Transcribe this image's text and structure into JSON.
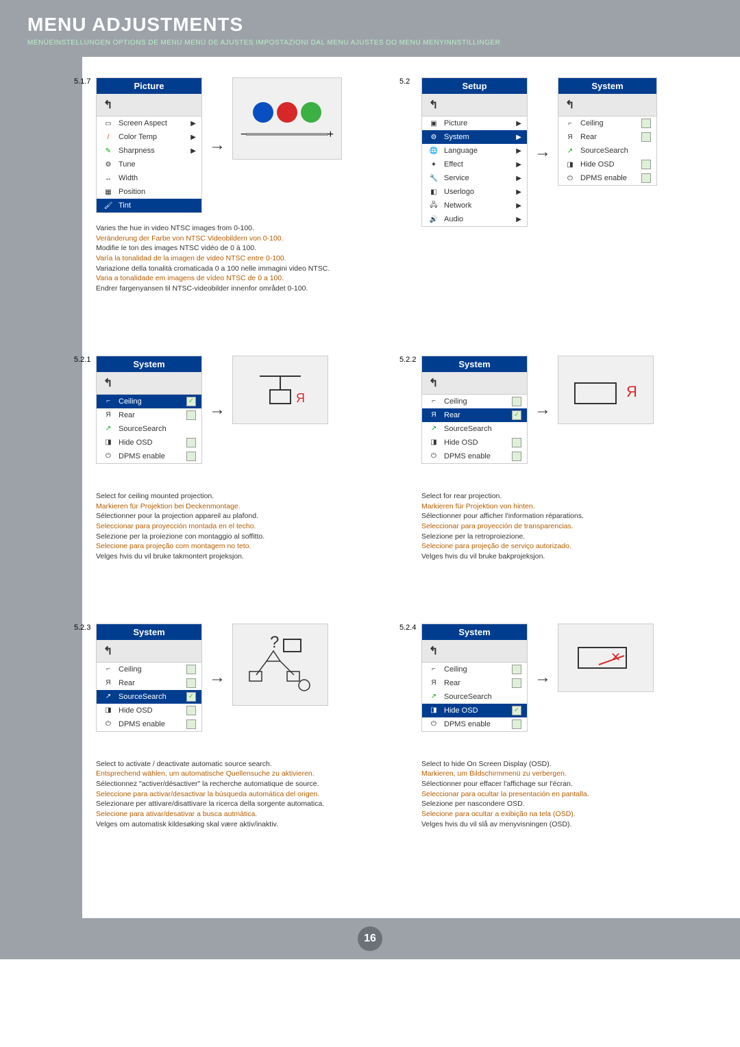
{
  "header": {
    "title": "MENU ADJUSTMENTS",
    "subtitle": "MENÜEINSTELLUNGEN   OPTIONS DE MENU   MENÚ DE AJUSTES   IMPOSTAZIONI DAL MENU   AJUSTES DO MENU   MENYINNSTILLINGER"
  },
  "sections": {
    "s517": {
      "num": "5.1.7",
      "menu_title": "Picture",
      "items": [
        "Screen Aspect",
        "Color Temp",
        "Sharpness",
        "Tune",
        "Width",
        "Position",
        "Tint"
      ],
      "desc": [
        "Varies the hue in video NTSC images from 0-100.",
        "Veränderung der Farbe von NTSC Videobildern von 0-100.",
        "Modifie le ton des images NTSC vidéo de 0 à 100.",
        "Varía la tonalidad de la imagen de video NTSC entre 0-100.",
        "Variazione della tonalità cromaticada 0 a 100 nelle immagini video NTSC.",
        "Varia a tonalidade em imagens de vídeo NTSC de 0 a 100.",
        "Endrer fargenyansen til NTSC-videobilder innenfor området 0-100."
      ]
    },
    "s52": {
      "num": "5.2",
      "menu_title": "Setup",
      "items": [
        "Picture",
        "System",
        "Language",
        "Effect",
        "Service",
        "Userlogo",
        "Network",
        "Audio"
      ],
      "side_title": "System",
      "side_items": [
        "Ceiling",
        "Rear",
        "SourceSearch",
        "Hide OSD",
        "DPMS enable"
      ]
    },
    "s521": {
      "num": "5.2.1",
      "menu_title": "System",
      "items": [
        "Ceiling",
        "Rear",
        "SourceSearch",
        "Hide OSD",
        "DPMS enable"
      ],
      "selected": "Ceiling",
      "desc": [
        "Select for ceiling mounted projection.",
        "Markieren für Projektion bei Deckenmontage.",
        "Sélectionner pour la projection appareil au plafond.",
        "Seleccionar para proyección montada en el techo.",
        "Selezione per la proiezione con montaggio al soffitto.",
        "Selecione para projeção com montagem no teto.",
        "Velges hvis du vil bruke takmontert projeksjon."
      ]
    },
    "s522": {
      "num": "5.2.2",
      "menu_title": "System",
      "items": [
        "Ceiling",
        "Rear",
        "SourceSearch",
        "Hide OSD",
        "DPMS enable"
      ],
      "selected": "Rear",
      "desc": [
        "Select for rear projection.",
        "Markieren für Projektion von hinten.",
        "Sélectionner pour afficher l'information réparations.",
        "Seleccionar para proyección de transparencias.",
        "Selezione per la retroproiezione.",
        "Selecione para projeção de serviço autorizado.",
        "Velges hvis du vil bruke bakprojeksjon."
      ]
    },
    "s523": {
      "num": "5.2.3",
      "menu_title": "System",
      "items": [
        "Ceiling",
        "Rear",
        "SourceSearch",
        "Hide OSD",
        "DPMS enable"
      ],
      "selected": "SourceSearch",
      "desc": [
        "Select to activate / deactivate automatic source search.",
        "Entsprechend wählen, um automatische Quellensuche zu aktivieren.",
        "Sélectionnez \"activer/désactiver\" la recherche automatique de source.",
        "Seleccione para activar/desactivar la búsqueda automática del origen.",
        "Selezionare per attivare/disattivare la ricerca della sorgente automatica.",
        "Selecione para ativar/desativar a busca autmática.",
        "Velges om automatisk kildesøking skal være aktiv/inaktiv."
      ]
    },
    "s524": {
      "num": "5.2.4",
      "menu_title": "System",
      "items": [
        "Ceiling",
        "Rear",
        "SourceSearch",
        "Hide OSD",
        "DPMS enable"
      ],
      "selected": "Hide OSD",
      "desc": [
        "Select to hide On Screen Display (OSD).",
        "Markieren, um Bildschirmmenü zu verbergen.",
        "Sélectionner pour effacer l'affichage sur l'écran.",
        "Seleccionar para ocultar la presentación en pantalla.",
        "Selezione per nascondere OSD.",
        "Selecione para ocultar a exibição na tela (OSD).",
        "Velges hvis du vil slå av menyvisningen (OSD)."
      ]
    }
  },
  "page_num": "16",
  "icon_R": "Я"
}
